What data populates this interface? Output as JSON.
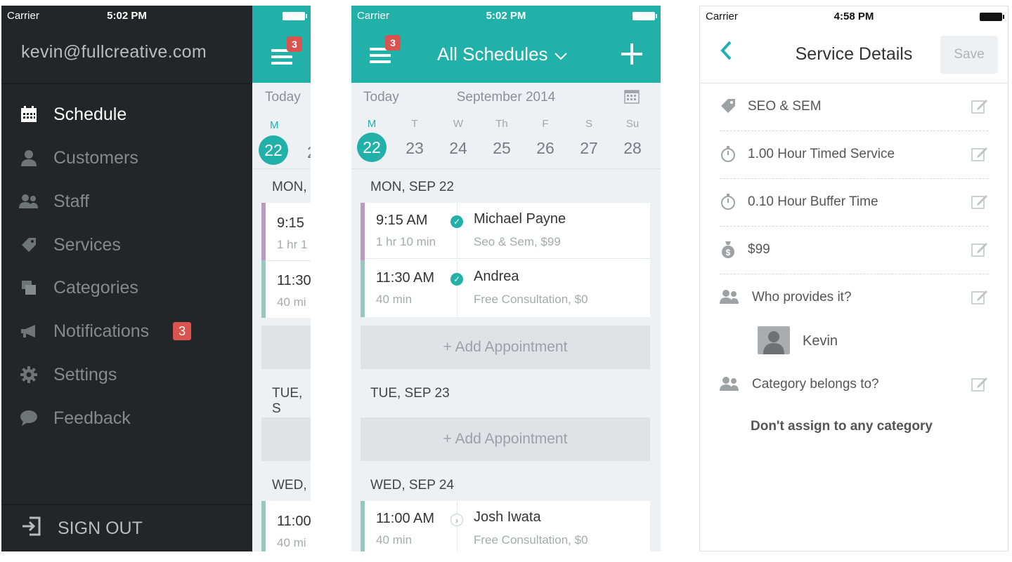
{
  "screen1": {
    "status": {
      "carrier": "Carrier",
      "time": "5:02 PM"
    },
    "email": "kevin@fullcreative.com",
    "menu": [
      {
        "label": "Schedule",
        "icon": "calendar-icon",
        "active": true
      },
      {
        "label": "Customers",
        "icon": "person-icon"
      },
      {
        "label": "Staff",
        "icon": "people-icon"
      },
      {
        "label": "Services",
        "icon": "tag-icon"
      },
      {
        "label": "Categories",
        "icon": "stack-icon"
      },
      {
        "label": "Notifications",
        "icon": "megaphone-icon",
        "badge": "3"
      },
      {
        "label": "Settings",
        "icon": "gear-icon"
      },
      {
        "label": "Feedback",
        "icon": "chat-bubble-icon"
      }
    ],
    "signout": "SIGN OUT",
    "peek": {
      "badge": "3",
      "today": "Today",
      "day_letter": "M",
      "day_num": "22",
      "mon": "MON,",
      "t1": "9:15",
      "d1": "1 hr 1",
      "t2": "11:30",
      "d2": "40 mi",
      "tue": "TUE, S",
      "wed": "WED,",
      "t3": "11:00",
      "d3": "40 mi"
    }
  },
  "screen2": {
    "status": {
      "carrier": "Carrier",
      "time": "5:02 PM"
    },
    "badge": "3",
    "title": "All Schedules",
    "today": "Today",
    "month": "September 2014",
    "days": [
      {
        "l": "M",
        "n": "22",
        "sel": true
      },
      {
        "l": "T",
        "n": "23"
      },
      {
        "l": "W",
        "n": "24"
      },
      {
        "l": "Th",
        "n": "25"
      },
      {
        "l": "F",
        "n": "26"
      },
      {
        "l": "S",
        "n": "27"
      },
      {
        "l": "Su",
        "n": "28"
      }
    ],
    "mon_header": "MON, SEP 22",
    "mon_appts": [
      {
        "time": "9:15 AM",
        "dur": "1 hr 10 min",
        "name": "Michael Payne",
        "svc": "Seo & Sem, $99",
        "status": "confirmed"
      },
      {
        "time": "11:30 AM",
        "dur": "40 min",
        "name": "Andrea",
        "svc": "Free Consultation, $0",
        "status": "confirmed"
      }
    ],
    "add_label": "+ Add Appointment",
    "tue_header": "TUE, SEP 23",
    "wed_header": "WED, SEP 24",
    "wed_appts": [
      {
        "time": "11:00 AM",
        "dur": "40 min",
        "name": "Josh Iwata",
        "svc": "Free Consultation, $0",
        "status": "pending"
      }
    ]
  },
  "screen3": {
    "status": {
      "carrier": "Carrier",
      "time": "4:58 PM"
    },
    "title": "Service Details",
    "save": "Save",
    "rows": [
      {
        "icon": "tag-icon",
        "text": "SEO & SEM"
      },
      {
        "icon": "stopwatch-icon",
        "text": "1.00 Hour Timed Service"
      },
      {
        "icon": "stopwatch-icon",
        "text": "0.10 Hour Buffer Time"
      },
      {
        "icon": "money-bag-icon",
        "text": "$99"
      },
      {
        "icon": "people-icon",
        "text": "Who provides it?"
      },
      {
        "icon": "people-icon",
        "text": "Category belongs to?"
      }
    ],
    "provider": "Kevin",
    "category_value": "Don't assign to any category"
  },
  "colors": {
    "teal": "#22b1a9",
    "drawer": "#222628",
    "badge": "#d9534f"
  }
}
